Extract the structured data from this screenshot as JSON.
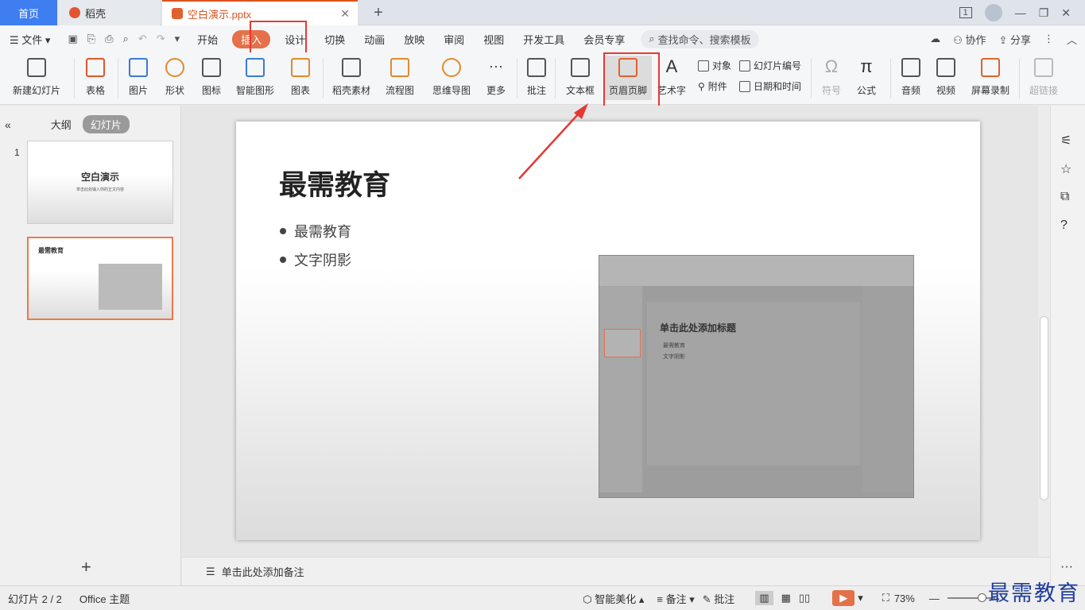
{
  "tabs": {
    "home": "首页",
    "daoke": "稻壳",
    "file": "空白演示.pptx"
  },
  "window": {
    "page_badge": "1"
  },
  "menu": {
    "file": "文件",
    "items": [
      "开始",
      "插入",
      "设计",
      "切换",
      "动画",
      "放映",
      "审阅",
      "视图",
      "开发工具",
      "会员专享"
    ],
    "active_index": 1,
    "search_placeholder": "查找命令、搜索模板",
    "collab": "协作",
    "share": "分享"
  },
  "ribbon": {
    "new_slide": "新建幻灯片",
    "table": "表格",
    "picture": "图片",
    "shape": "形状",
    "icon": "图标",
    "smart_graphic": "智能图形",
    "chart": "图表",
    "daoke_material": "稻壳素材",
    "flowchart": "流程图",
    "mindmap": "思维导图",
    "more": "更多",
    "comment": "批注",
    "textbox": "文本框",
    "header_footer": "页眉页脚",
    "wordart": "艺术字",
    "object": "对象",
    "slide_number": "幻灯片编号",
    "attachment": "附件",
    "date_time": "日期和时间",
    "symbol": "符号",
    "formula": "公式",
    "audio": "音频",
    "video": "视频",
    "screen_record": "屏幕录制",
    "hyperlink": "超链接"
  },
  "left_panel": {
    "outline": "大纲",
    "slides": "幻灯片",
    "slide1_title": "空白演示",
    "slide1_sub": "单击此处输入你的正文内容",
    "slide2_title": "最需教育",
    "slide1_num": "1"
  },
  "slide": {
    "title": "最需教育",
    "bullets": [
      "最需教育",
      "文字阴影"
    ]
  },
  "embedded": {
    "title": "单击此处添加标题",
    "bullets": [
      "最需教育",
      "文字阴影"
    ]
  },
  "notes": {
    "placeholder": "单击此处添加备注"
  },
  "status": {
    "slide_count": "幻灯片 2 / 2",
    "theme": "Office 主题",
    "beautify": "智能美化",
    "notes": "备注",
    "comments": "批注",
    "zoom": "73%"
  },
  "watermark": "最需教育",
  "colors": {
    "accent": "#e4714a",
    "brand_blue": "#3f7ef0",
    "highlight": "#e53935"
  }
}
